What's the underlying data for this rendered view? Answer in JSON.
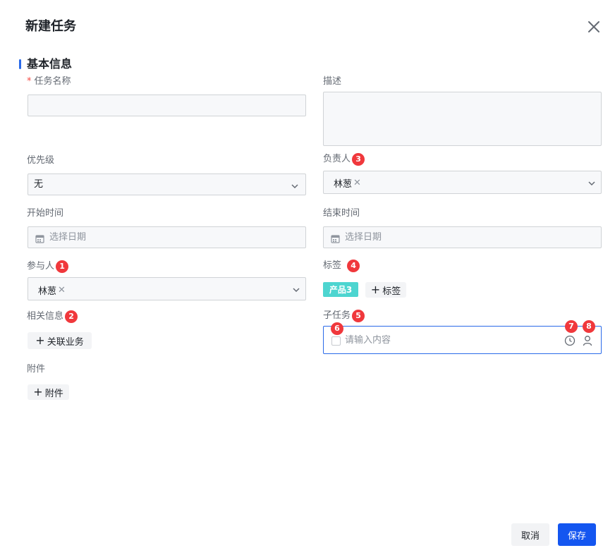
{
  "dialog": {
    "title": "新建任务"
  },
  "section": {
    "title": "基本信息"
  },
  "task_name": {
    "label": "任务名称",
    "required_mark": "*",
    "value": ""
  },
  "description": {
    "label": "描述",
    "value": ""
  },
  "priority": {
    "label": "优先级",
    "value": "无"
  },
  "assignee": {
    "label": "负责人",
    "chips": [
      "林葱"
    ],
    "badge": "3"
  },
  "start_time": {
    "label": "开始时间",
    "placeholder": "选择日期"
  },
  "end_time": {
    "label": "结束时间",
    "placeholder": "选择日期"
  },
  "participants": {
    "label": "参与人",
    "chips": [
      "林葱"
    ],
    "badge": "1"
  },
  "tags": {
    "label": "标签",
    "badge": "4",
    "items": [
      "产品3"
    ],
    "add_label": "标签"
  },
  "related": {
    "label": "相关信息",
    "badge": "2",
    "add_label": "关联业务"
  },
  "subtask": {
    "label": "子任务",
    "badge": "5",
    "placeholder": "请输入内容",
    "checkbox_badge": "6",
    "clock_badge": "7",
    "user_badge": "8"
  },
  "attachment": {
    "label": "附件",
    "add_label": "附件"
  },
  "footer": {
    "cancel_label": "取消",
    "save_label": "保存"
  },
  "colors": {
    "accent": "#1456f0",
    "badge": "#f0383c",
    "tag": "#4dd5d0",
    "focus_border": "#2a6ae9"
  },
  "icons": {
    "close": "close-icon",
    "calendar": "calendar-icon",
    "chevron": "chevron-down-icon",
    "clock": "clock-icon",
    "user": "user-icon",
    "plus": "plus-icon",
    "remove": "remove-chip-icon"
  }
}
